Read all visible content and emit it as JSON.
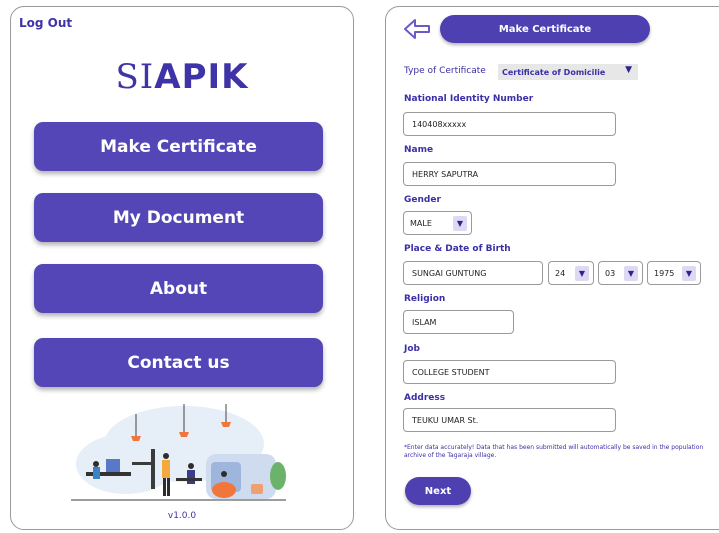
{
  "home": {
    "logout": "Log Out",
    "logo_prefix": "SI",
    "logo_bold": "APIK",
    "menu": [
      "Make Certificate",
      "My Document",
      "About",
      "Contact us"
    ],
    "version": "v1.0.0"
  },
  "form": {
    "header": "Make Certificate",
    "type_label": "Type of Certificate",
    "type_value": "Certificate of Domicilie",
    "nin_label": "National Identity Number",
    "nin_value": "140408xxxxx",
    "name_label": "Name",
    "name_value": "HERRY SAPUTRA",
    "gender_label": "Gender",
    "gender_value": "MALE",
    "birth_label": "Place & Date of Birth",
    "birth_place": "SUNGAI GUNTUNG",
    "birth_day": "24",
    "birth_month": "03",
    "birth_year": "1975",
    "religion_label": "Religion",
    "religion_value": "ISLAM",
    "job_label": "Job",
    "job_value": "COLLEGE STUDENT",
    "address_label": "Address",
    "address_value": "TEUKU UMAR St.",
    "note": "*Enter data accurately! Data that has been submitted will automatically be saved in the population archive of the Tagaraja village.",
    "next": "Next"
  },
  "colors": {
    "primary": "#5446b6",
    "text": "#3b2fa6"
  }
}
